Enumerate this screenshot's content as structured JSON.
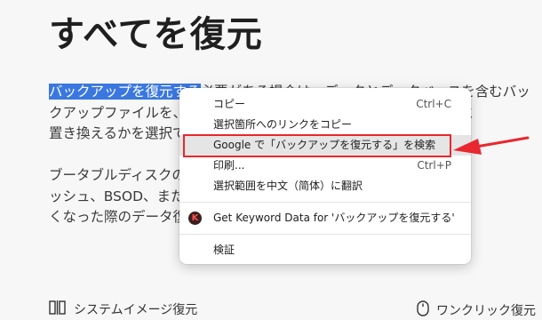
{
  "page": {
    "title": "すべてを復元",
    "para1": {
      "highlighted": "バックアップを復元する",
      "line1_rest": "必要がある場合は、データとデータベースを含むバッ",
      "line2": "クアップファイルを、ディスクまたはパーティション上のファイルと",
      "line3": "置き換えるかを選択できます。"
    },
    "para2": {
      "line1": "ブータブルディスクの作成機能を使えば、Windowsがシステムクラ",
      "line2": "ッシュ、BSOD、またはその他の不具合によりパソコンが起動しな",
      "line3": "くなった際のデータ復旧も可能です。"
    },
    "features": {
      "left_label": "システムイメージ復元",
      "right_label": "ワンクリック復元"
    }
  },
  "context_menu": {
    "copy": "コピー",
    "copy_shortcut": "Ctrl+C",
    "copy_link": "選択箇所へのリンクをコピー",
    "search": "Google で「バックアップを復元する」を検索",
    "print": "印刷...",
    "print_shortcut": "Ctrl+P",
    "translate": "選択範囲を中文（简体）に翻訳",
    "keyword_icon_letter": "K",
    "keyword": "Get Keyword Data for 'バックアップを復元する'",
    "inspect": "検証"
  },
  "colors": {
    "selection": "#3a78e0",
    "annotation_red": "#e8282e",
    "menu_hover": "#e5e5e5"
  }
}
